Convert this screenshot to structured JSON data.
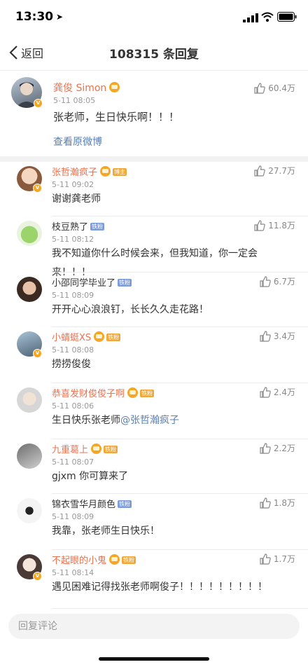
{
  "status": {
    "time": "13:30"
  },
  "nav": {
    "back_label": "返回",
    "title": "108315 条回复"
  },
  "original": {
    "user": "龚俊 Simon",
    "time": "5-11 08:05",
    "text": "张老师，生日快乐啊！！！",
    "likes": "60.4万",
    "view_original": "查看原微博"
  },
  "comments": [
    {
      "user": "张哲瀚疯子",
      "name_color": "orange",
      "crown": true,
      "tag": "博主",
      "tag_type": "gold",
      "time": "5-11 09:02",
      "text": "谢谢龚老师",
      "likes": "27.7万",
      "vbadge": true
    },
    {
      "user": "枝豆熟了",
      "name_color": "dark",
      "crown": false,
      "tag": "铁粉",
      "tag_type": "fan",
      "time": "5-11 08:12",
      "text": "我不知道你什么时候会来，但我知道，你一定会来！！！",
      "likes": "11.8万",
      "vbadge": false
    },
    {
      "user": "小邵同学毕业了",
      "name_color": "dark",
      "crown": false,
      "tag": "铁粉",
      "tag_type": "fan",
      "time": "5-11 08:09",
      "text": "开开心心浪浪钉，长长久久走花路！",
      "likes": "6.7万",
      "vbadge": false
    },
    {
      "user": "小蜻蜓XS",
      "name_color": "orange",
      "crown": true,
      "tag": "铁粉",
      "tag_type": "gold",
      "time": "5-11 08:08",
      "text": "捞捞俊俊",
      "likes": "3.4万",
      "vbadge": true
    },
    {
      "user": "恭喜发财俊俊子啊",
      "name_color": "orange",
      "crown": true,
      "tag": "铁粉",
      "tag_type": "gold",
      "time": "5-11 08:06",
      "text": "生日快乐张老师",
      "mention": "@张哲瀚疯子",
      "likes": "2.4万",
      "vbadge": false
    },
    {
      "user": "九重葛上",
      "name_color": "orange",
      "crown": true,
      "tag": "铁粉",
      "tag_type": "gold",
      "time": "5-11 08:07",
      "text": "gjxm 你可算来了",
      "likes": "2.2万",
      "vbadge": false
    },
    {
      "user": "锦衣雪华月颜色",
      "name_color": "dark",
      "crown": false,
      "tag": "铁粉",
      "tag_type": "fan",
      "time": "5-11 08:09",
      "text": "我靠，张老师生日快乐！",
      "likes": "1.8万",
      "vbadge": false
    },
    {
      "user": "不起眼的小鬼",
      "name_color": "orange",
      "crown": true,
      "tag": "铁粉",
      "tag_type": "gold",
      "time": "5-11 08:14",
      "text": "遇见困难记得找张老师啊俊子！！！！！！！！！",
      "likes": "1.7万",
      "vbadge": true
    }
  ],
  "reply": {
    "placeholder": "回复评论"
  },
  "colors": {
    "accent": "#eb7350",
    "link": "#5a7fb3"
  }
}
